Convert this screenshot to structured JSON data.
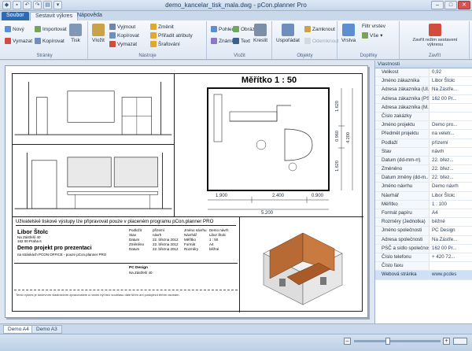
{
  "window": {
    "title": "demo_kancelar_tisk_mala.dwg - pCon.planner Pro"
  },
  "quick_access": [
    "save-icon",
    "undo-icon",
    "redo-icon",
    "print-icon",
    "open-icon"
  ],
  "tabs": [
    {
      "label": "Soubor"
    },
    {
      "label": "Sestavit výkres"
    },
    {
      "label": "Nápověda"
    }
  ],
  "ribbon": {
    "groups": {
      "stranky": "Stránky",
      "nastroje": "Nástroje",
      "vlozit": "Vložit",
      "objekty": "Objekty",
      "doplnky": "Doplňky",
      "zavrit": "Zavřít"
    },
    "items": {
      "novy": "Nový",
      "importovat": "Importovat",
      "vymazat": "Vymazat",
      "kopirovat": "Kopírovat",
      "tisk": "Tisk",
      "vlozit": "Vložit",
      "vyjmout": "Vyjmout",
      "kopirovat2": "Kopírovat",
      "vymazat2": "Vymazat",
      "zmenit": "Změnit",
      "prirazit": "Přiřadit atributy",
      "srafovani": "Šrafování",
      "pohled": "Pohled",
      "obrazek": "Obrázek",
      "znamka": "Známka",
      "text": "Text",
      "kreslit": "Kreslit",
      "usporadat": "Uspořádat",
      "zamknout": "Zamknout",
      "odemknout": "Odemknout",
      "vrstva": "Vrstva",
      "filtr_vrstev": "Filtr vrstev",
      "vse": "Vše",
      "zavrit_rezim": "Zavřít režim sestavení výkresu"
    }
  },
  "drawing": {
    "scale_title": "Měřítko 1 : 50",
    "dims": {
      "d1": "1.900",
      "d2": "2.400",
      "d3": "0.900",
      "total": "5.200",
      "v1": "1.620",
      "v2": "0.960",
      "v3": "1.620",
      "v4": "4.200"
    },
    "info_heading": "Uživatelské tiskové výstupy lze připravovat pouze v placeném programu pCon.planner PRO",
    "customer_name": "Libor Štolc",
    "addr1": "Na Zástřeší 40",
    "addr2": "162 00 Praha 6",
    "project_title": "Demo projekt pro prezentaci",
    "project_sub": "na stránkách PCON OFFICE - pouze pCon.planner PRO",
    "tb_labels": [
      "Podložit",
      "Stav",
      "Datum",
      "Změněno",
      "Datum"
    ],
    "tb_values": [
      "přízemí",
      "návrh",
      "22. března 2012",
      "22. března 2012",
      "22. března 2012"
    ],
    "tb_labels2": [
      "Jméno návrhu",
      "Návrhář",
      "Měřítko",
      "Formát",
      "Rozměry"
    ],
    "tb_values2": [
      "Demo návrh",
      "Libor Štolc",
      "1 : 50",
      "A4",
      "běžné"
    ],
    "company": "PC Design",
    "company_addr": "Na Zástřeší 40",
    "footer_note": "Tento výkres je duševním vlastnictvím zpracovatele a nesmí být bez souhlasu dále šířen ani poskytnut třetím osobám."
  },
  "properties": {
    "title": "Vlastnosti",
    "rows": [
      {
        "k": "Velikost",
        "v": "0,92"
      },
      {
        "k": "Jméno zákazníka",
        "v": "Libor Štolc"
      },
      {
        "k": "Adresa zákazníka (Ul...",
        "v": "Na Zástře..."
      },
      {
        "k": "Adresa zákazníka (PSČ)",
        "v": "162 00 Pr..."
      },
      {
        "k": "Adresa zákazníka (M...",
        "v": ""
      },
      {
        "k": "Číslo zakázky",
        "v": ""
      },
      {
        "k": "Jméno projektu",
        "v": "Demo pro..."
      },
      {
        "k": "Předmět projektu",
        "v": "na veletr..."
      },
      {
        "k": "Podlaží",
        "v": "přízemí"
      },
      {
        "k": "Stav",
        "v": "návrh"
      },
      {
        "k": "Datum (dd-mm-rr)",
        "v": "22. břez..."
      },
      {
        "k": "Změněno",
        "v": "22. břez..."
      },
      {
        "k": "Datum změny (dd-m...",
        "v": "22. břez..."
      },
      {
        "k": "Jméno návrhu",
        "v": "Demo návrh"
      },
      {
        "k": "Návrhář",
        "v": "Libor Štolc"
      },
      {
        "k": "Měřítko",
        "v": "1 : 100"
      },
      {
        "k": "Formát papíru",
        "v": "A4"
      },
      {
        "k": "Rozměry (Jednotka)",
        "v": "běžné"
      },
      {
        "k": "Jméno společnosti",
        "v": "PC Design"
      },
      {
        "k": "Adresa společnosti",
        "v": "Na Zástře..."
      },
      {
        "k": "PSČ a sídlo společnosti",
        "v": "162 00 Pr..."
      },
      {
        "k": "Číslo telefonu",
        "v": "+ 420 72..."
      },
      {
        "k": "Číslo faxu",
        "v": ""
      },
      {
        "k": "Webová stránka",
        "v": "www.pcdes"
      }
    ]
  },
  "sheets": [
    {
      "label": "Demo A4"
    },
    {
      "label": "Demo A3"
    }
  ]
}
